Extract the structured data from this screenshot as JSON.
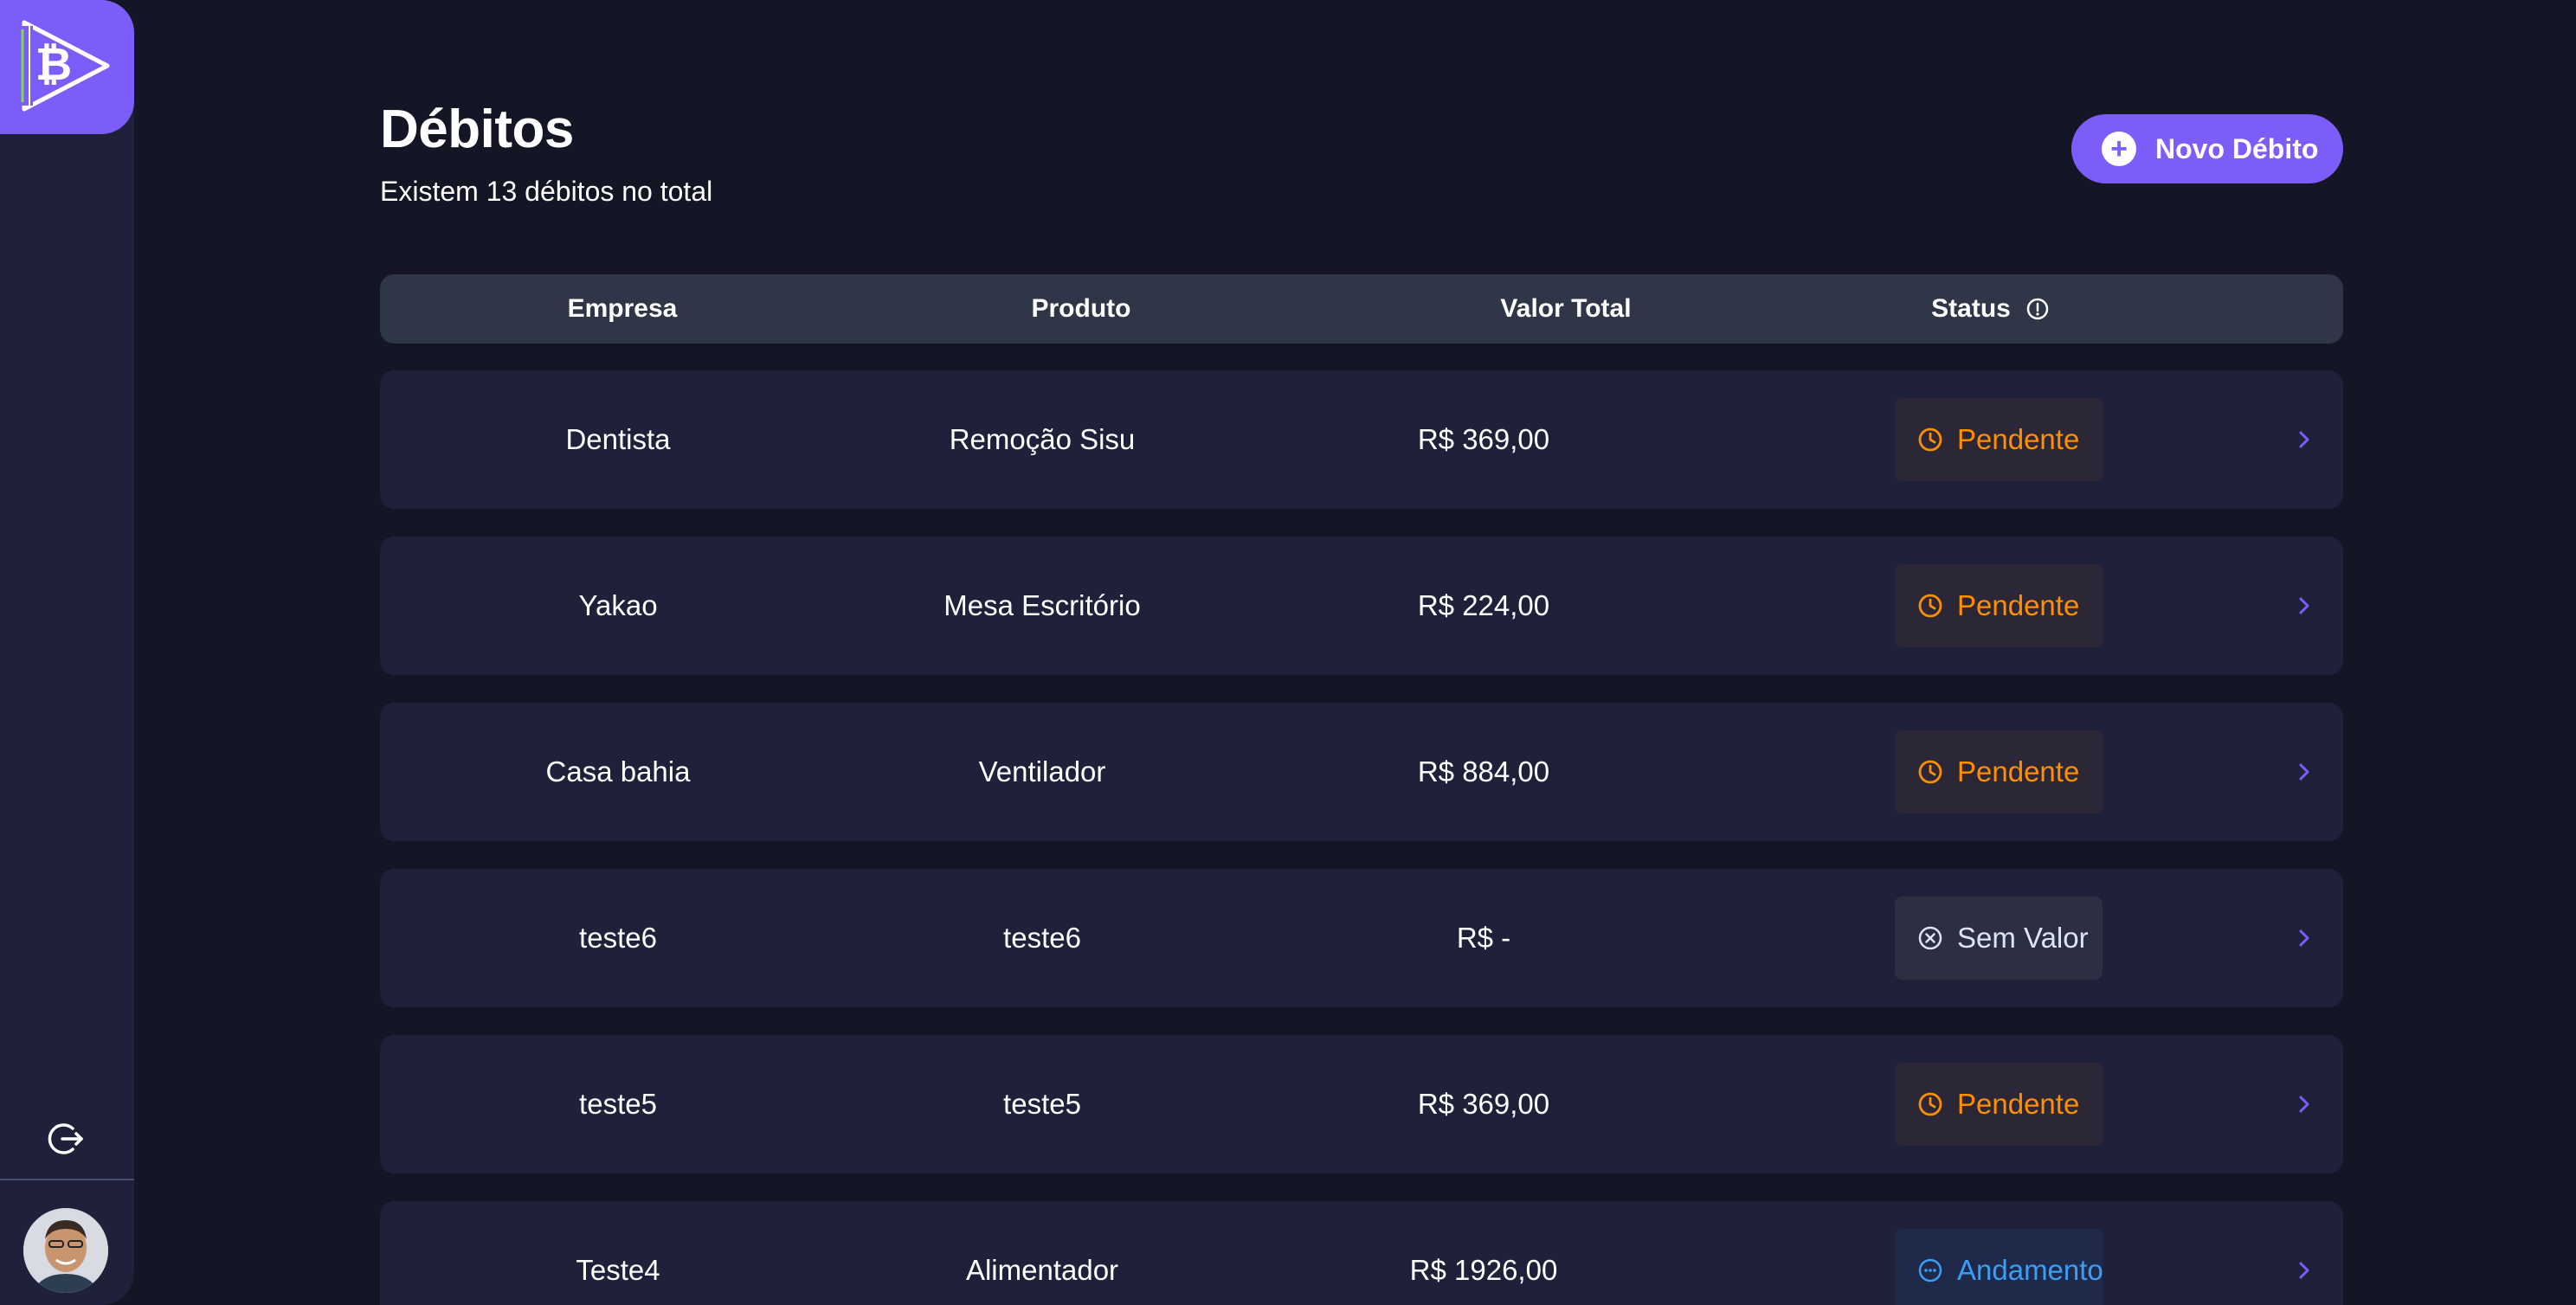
{
  "colors": {
    "background": "#141625",
    "sidebar": "#1e2139",
    "accent": "#7c5dfa",
    "pending": "#ff8f00",
    "none": "#dfe3fa",
    "progress": "#3b9df5"
  },
  "sidebar": {
    "logo_icon": "bitcoin-play-logo",
    "logout_icon": "logout-icon",
    "avatar_icon": "user-avatar"
  },
  "header": {
    "title": "Débitos",
    "subtitle": "Existem 13 débitos no total",
    "new_button_label": "Novo Débito",
    "new_button_icon": "plus-icon"
  },
  "table": {
    "columns": [
      "Empresa",
      "Produto",
      "Valor Total",
      "Status"
    ],
    "status_info_icon": "info-icon",
    "rows": [
      {
        "empresa": "Dentista",
        "produto": "Remoção Sisu",
        "valor": "R$ 369,00",
        "status": "Pendente",
        "status_type": "pending"
      },
      {
        "empresa": "Yakao",
        "produto": "Mesa Escritório",
        "valor": "R$ 224,00",
        "status": "Pendente",
        "status_type": "pending"
      },
      {
        "empresa": "Casa bahia",
        "produto": "Ventilador",
        "valor": "R$ 884,00",
        "status": "Pendente",
        "status_type": "pending"
      },
      {
        "empresa": "teste6",
        "produto": "teste6",
        "valor": "R$ -",
        "status": "Sem Valor",
        "status_type": "none"
      },
      {
        "empresa": "teste5",
        "produto": "teste5",
        "valor": "R$ 369,00",
        "status": "Pendente",
        "status_type": "pending"
      },
      {
        "empresa": "Teste4",
        "produto": "Alimentador",
        "valor": "R$ 1926,00",
        "status": "Andamento",
        "status_type": "progress"
      }
    ]
  }
}
